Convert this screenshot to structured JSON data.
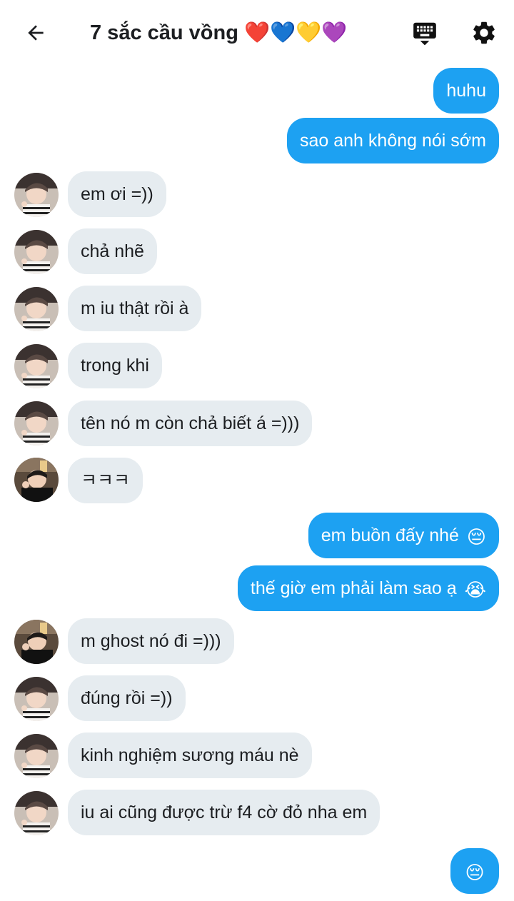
{
  "header": {
    "title": "7 sắc cầu vồng",
    "hearts": [
      "❤️",
      "💙",
      "💛",
      "💜"
    ]
  },
  "messages": [
    {
      "side": "out",
      "text": "huhu"
    },
    {
      "side": "out",
      "text": "sao anh không nói sớm"
    },
    {
      "side": "in",
      "avatar": "a",
      "text": "em ơi =))"
    },
    {
      "side": "in",
      "avatar": "a",
      "text": "chả nhẽ"
    },
    {
      "side": "in",
      "avatar": "a",
      "text": "m iu thật rồi à"
    },
    {
      "side": "in",
      "avatar": "a",
      "text": "trong khi"
    },
    {
      "side": "in",
      "avatar": "a",
      "text": "tên nó m còn chả biết á =)))"
    },
    {
      "side": "in",
      "avatar": "b",
      "text": "ㅋㅋㅋ"
    },
    {
      "side": "out",
      "text": "em buồn đấy nhé",
      "emoji": "😔"
    },
    {
      "side": "out",
      "text": "thế giờ em phải làm sao ạ",
      "emoji": "😭"
    },
    {
      "side": "in",
      "avatar": "b",
      "text": "m ghost nó đi =)))"
    },
    {
      "side": "in",
      "avatar": "a",
      "text": "đúng rồi =))"
    },
    {
      "side": "in",
      "avatar": "a",
      "text": "kinh nghiệm sương máu nè"
    },
    {
      "side": "in",
      "avatar": "a",
      "text": "iu ai cũng được trừ f4 cờ đỏ nha em"
    },
    {
      "side": "out",
      "text": "",
      "emoji": "😔"
    }
  ],
  "colors": {
    "outgoing_bubble": "#1da1f2",
    "incoming_bubble": "#e6ecf0",
    "text_dark": "#1c1e21"
  },
  "icons": [
    "back-arrow-icon",
    "keyboard-icon",
    "gear-icon"
  ]
}
